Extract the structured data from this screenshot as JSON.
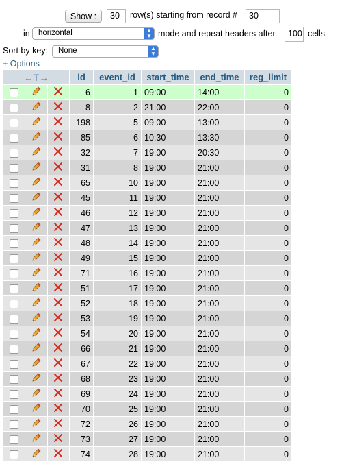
{
  "controls": {
    "show_label": "Show :",
    "rows_value": "30",
    "rows_text": "row(s) starting from record #",
    "start_value": "30",
    "in_label": "in",
    "mode_value": "horizontal",
    "mode_text": "mode and repeat headers after",
    "repeat_value": "100",
    "cells_label": "cells",
    "sort_label": "Sort by key:",
    "sort_value": "None",
    "options_link": "+ Options"
  },
  "table": {
    "arrows_glyph": "←T→",
    "columns": [
      "id",
      "event_id",
      "start_time",
      "end_time",
      "reg_limit"
    ],
    "rows": [
      [
        "6",
        "1",
        "09:00",
        "14:00",
        "0"
      ],
      [
        "8",
        "2",
        "21:00",
        "22:00",
        "0"
      ],
      [
        "198",
        "5",
        "09:00",
        "13:00",
        "0"
      ],
      [
        "85",
        "6",
        "10:30",
        "13:30",
        "0"
      ],
      [
        "32",
        "7",
        "19:00",
        "20:30",
        "0"
      ],
      [
        "31",
        "8",
        "19:00",
        "21:00",
        "0"
      ],
      [
        "65",
        "10",
        "19:00",
        "21:00",
        "0"
      ],
      [
        "45",
        "11",
        "19:00",
        "21:00",
        "0"
      ],
      [
        "46",
        "12",
        "19:00",
        "21:00",
        "0"
      ],
      [
        "47",
        "13",
        "19:00",
        "21:00",
        "0"
      ],
      [
        "48",
        "14",
        "19:00",
        "21:00",
        "0"
      ],
      [
        "49",
        "15",
        "19:00",
        "21:00",
        "0"
      ],
      [
        "71",
        "16",
        "19:00",
        "21:00",
        "0"
      ],
      [
        "51",
        "17",
        "19:00",
        "21:00",
        "0"
      ],
      [
        "52",
        "18",
        "19:00",
        "21:00",
        "0"
      ],
      [
        "53",
        "19",
        "19:00",
        "21:00",
        "0"
      ],
      [
        "54",
        "20",
        "19:00",
        "21:00",
        "0"
      ],
      [
        "66",
        "21",
        "19:00",
        "21:00",
        "0"
      ],
      [
        "67",
        "22",
        "19:00",
        "21:00",
        "0"
      ],
      [
        "68",
        "23",
        "19:00",
        "21:00",
        "0"
      ],
      [
        "69",
        "24",
        "19:00",
        "21:00",
        "0"
      ],
      [
        "70",
        "25",
        "19:00",
        "21:00",
        "0"
      ],
      [
        "72",
        "26",
        "19:00",
        "21:00",
        "0"
      ],
      [
        "73",
        "27",
        "19:00",
        "21:00",
        "0"
      ],
      [
        "74",
        "28",
        "19:00",
        "21:00",
        "0"
      ]
    ],
    "highlight_color": "#ccffcc",
    "header_color": "#d3dce3",
    "link_color": "#235a81"
  },
  "icons": {
    "edit": "pencil-icon",
    "delete": "delete-x-icon"
  }
}
